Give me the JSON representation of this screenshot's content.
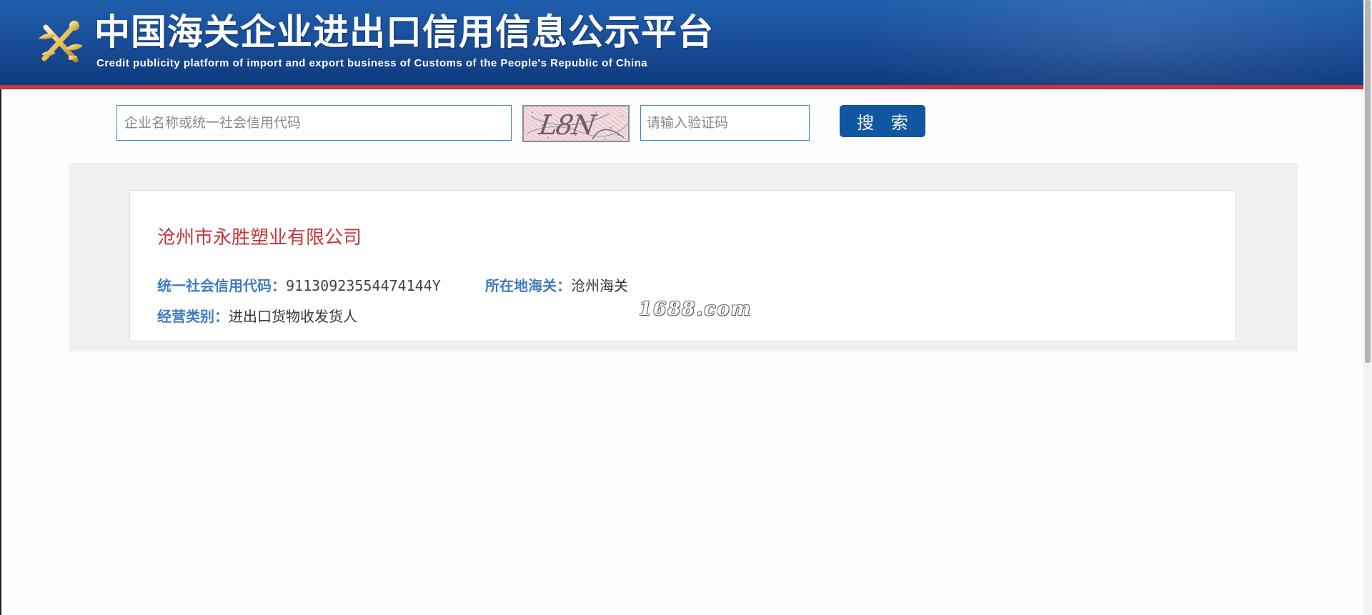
{
  "header": {
    "title": "中国海关企业进出口信用信息公示平台",
    "subtitle": "Credit publicity platform of import and export business of Customs of the People's Republic of China",
    "emblem_icon": "customs-emblem-icon"
  },
  "search": {
    "query_placeholder": "企业名称或统一社会信用代码",
    "captcha_text": "L8N",
    "captcha_placeholder": "请输入验证码",
    "button_label": "搜 索"
  },
  "result": {
    "company_name": "沧州市永胜塑业有限公司",
    "credit_code_label": "统一社会信用代码：",
    "credit_code_value": "91130923554474144Y",
    "customs_label": "所在地海关：",
    "customs_value": "沧州海关",
    "category_label": "经营类别：",
    "category_value": "进出口货物收发货人"
  },
  "watermark": "1688.com",
  "colors": {
    "header_blue": "#1b4f9a",
    "header_red_line": "#c8333c",
    "button_blue": "#1156a0",
    "company_red": "#c7353a",
    "label_blue": "#3f7cc0"
  }
}
